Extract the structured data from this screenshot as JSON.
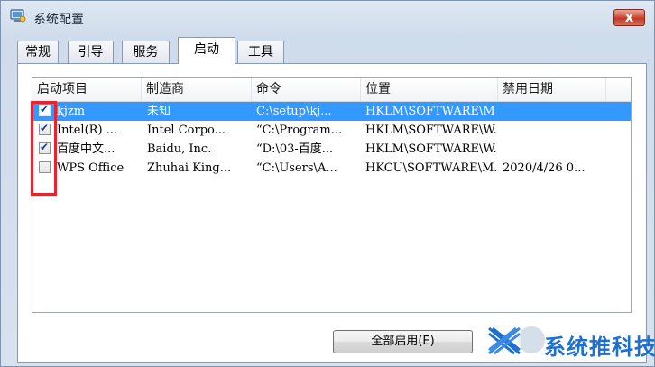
{
  "window": {
    "title": "系统配置",
    "close_label": "x"
  },
  "tabs": [
    {
      "label": "常规",
      "active": false
    },
    {
      "label": "引导",
      "active": false
    },
    {
      "label": "服务",
      "active": false
    },
    {
      "label": "启动",
      "active": true
    },
    {
      "label": "工具",
      "active": false
    }
  ],
  "columns": [
    "启动项目",
    "制造商",
    "命令",
    "位置",
    "禁用日期"
  ],
  "rows": [
    {
      "checked": true,
      "selected": true,
      "cells": [
        "kjzm",
        "未知",
        "C:\\setup\\kj...",
        "HKLM\\SOFTWARE\\M...",
        ""
      ]
    },
    {
      "checked": true,
      "selected": false,
      "cells": [
        "Intel(R) ...",
        "Intel Corpo...",
        "“C:\\Program...",
        "HKLM\\SOFTWARE\\W...",
        ""
      ]
    },
    {
      "checked": true,
      "selected": false,
      "cells": [
        "百度中文...",
        "Baidu, Inc.",
        "“D:\\03-百度...",
        "HKLM\\SOFTWARE\\W...",
        ""
      ]
    },
    {
      "checked": false,
      "selected": false,
      "cells": [
        "WPS Office",
        "Zhuhai King...",
        "“C:\\Users\\A...",
        "HKCU\\SOFTWARE\\M...",
        "2020/4/26 0..."
      ]
    }
  ],
  "buttons": {
    "enable_all": "全部启用(E)"
  },
  "watermark": {
    "text": "系统推科技",
    "color": "#1d6fd1"
  },
  "colors": {
    "selection": "#3399ff",
    "annotation": "#e8232e"
  }
}
